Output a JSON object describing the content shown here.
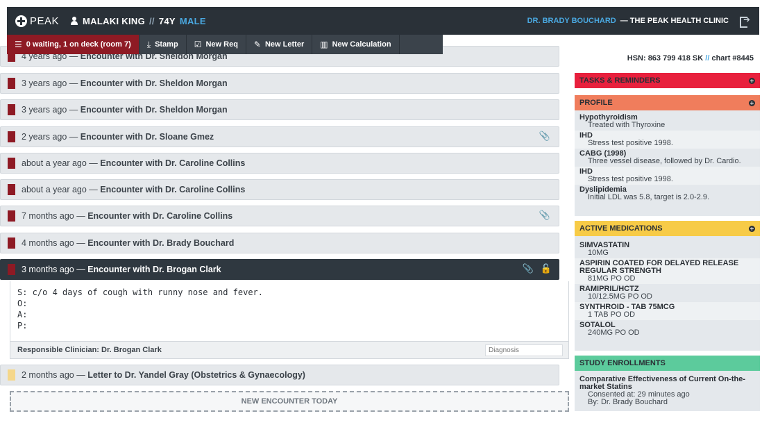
{
  "header": {
    "logo": "PEAK",
    "patient_name": "MALAKI KING",
    "separator": "//",
    "age": "74Y",
    "sex": "MALE",
    "doctor": "DR. BRADY BOUCHARD",
    "clinic": "— THE PEAK HEALTH CLINIC"
  },
  "toolbar": {
    "waiting": "0 waiting, 1 on deck (room 7)",
    "stamp": "Stamp",
    "new_req": "New Req",
    "new_letter": "New Letter",
    "new_calculation": "New Calculation"
  },
  "encounters": [
    {
      "when": "4 years ago —",
      "title": "Encounter with Dr. Sheldon Morgan"
    },
    {
      "when": "3 years ago —",
      "title": "Encounter with Dr. Sheldon Morgan"
    },
    {
      "when": "3 years ago —",
      "title": "Encounter with Dr. Sheldon Morgan"
    },
    {
      "when": "2 years ago —",
      "title": "Encounter with Dr. Sloane Gmez"
    },
    {
      "when": "about a year ago —",
      "title": "Encounter with Dr. Caroline Collins"
    },
    {
      "when": "about a year ago —",
      "title": "Encounter with Dr. Caroline Collins"
    },
    {
      "when": "7 months ago —",
      "title": "Encounter with Dr. Caroline Collins"
    },
    {
      "when": "4 months ago —",
      "title": "Encounter with Dr. Brady Bouchard"
    },
    {
      "when": "3 months ago —",
      "title": "Encounter with Dr. Brogan Clark"
    },
    {
      "when": "2 months ago —",
      "title": "Letter to Dr. Yandel Gray (Obstetrics & Gynaecology)"
    }
  ],
  "soap_note": "S: c/o 4 days of cough with runny nose and fever.\nO:\nA:\nP:",
  "responsible": "Responsible Clinician: Dr. Brogan Clark",
  "diagnosis_placeholder": "Diagnosis",
  "new_encounter": "NEW ENCOUNTER TODAY",
  "sidebar": {
    "hsn_prefix": "HSN: 863 799 418 SK",
    "hsn_sep": "//",
    "chart": "chart #8445",
    "tasks_title": "TASKS & REMINDERS",
    "profile_title": "PROFILE",
    "profile": [
      {
        "k": "Hypothyroidism",
        "v": "Treated with Thyroxine"
      },
      {
        "k": "IHD",
        "v": "Stress test positive 1998."
      },
      {
        "k": "CABG (1998)",
        "v": "Three vessel disease, followed by Dr. Cardio."
      },
      {
        "k": "IHD",
        "v": "Stress test positive 1998."
      },
      {
        "k": "Dyslipidemia",
        "v": "Initial LDL was 5.8, target is 2.0-2.9."
      }
    ],
    "meds_title": "ACTIVE MEDICATIONS",
    "meds": [
      {
        "k": "SIMVASTATIN",
        "v": "10MG"
      },
      {
        "k": "ASPIRIN COATED FOR DELAYED RELEASE REGULAR STRENGTH",
        "v": "81MG PO OD"
      },
      {
        "k": "RAMIPRIL/HCTZ",
        "v": "10/12.5MG PO OD"
      },
      {
        "k": "SYNTHROID - TAB 75MCG",
        "v": "1 TAB PO OD"
      },
      {
        "k": "SOTALOL",
        "v": "240MG PO OD"
      }
    ],
    "study_title": "STUDY ENROLLMENTS",
    "study_name": "Comparative Effectiveness of Current On-the-market Statins",
    "study_consent": "Consented at: 29 minutes ago",
    "study_by": "By: Dr. Brady Bouchard"
  },
  "colors": {
    "tasks": "#e8203d",
    "profile": "#f07d5c",
    "meds": "#f7cb47",
    "study": "#5ccb9c",
    "flag": "#8e1a24",
    "letter_flag": "#f5d78a"
  }
}
